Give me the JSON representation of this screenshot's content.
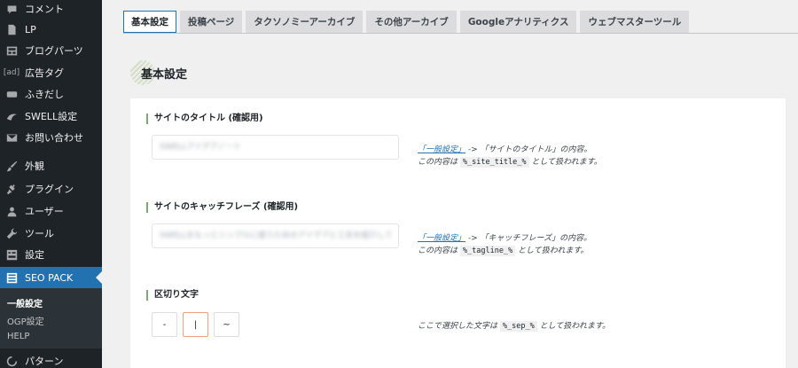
{
  "sidebar": {
    "items": [
      {
        "label": "コメント",
        "icon": "comment-icon"
      },
      {
        "label": "LP",
        "icon": "document-icon"
      },
      {
        "label": "ブログパーツ",
        "icon": "layout-icon"
      },
      {
        "label": "広告タグ",
        "icon_text": "[ad]",
        "icon": "ad-icon"
      },
      {
        "label": "ふきだし",
        "icon": "speech-bubble-icon"
      },
      {
        "label": "SWELL設定",
        "icon": "swell-icon"
      },
      {
        "label": "お問い合わせ",
        "icon": "mail-icon"
      },
      {
        "label": "外観",
        "icon": "paintbrush-icon"
      },
      {
        "label": "プラグイン",
        "icon": "plugin-icon"
      },
      {
        "label": "ユーザー",
        "icon": "user-icon"
      },
      {
        "label": "ツール",
        "icon": "wrench-icon"
      },
      {
        "label": "設定",
        "icon": "settings-icon"
      },
      {
        "label": "SEO PACK",
        "icon": "list-icon"
      },
      {
        "label": "パターン",
        "icon": "pattern-icon"
      }
    ],
    "submenu": [
      "一般設定",
      "OGP設定",
      "HELP"
    ]
  },
  "tabs": [
    "基本設定",
    "投稿ページ",
    "タクソノミーアーカイブ",
    "その他アーカイブ",
    "Googleアナリティクス",
    "ウェブマスターツール"
  ],
  "section_title": "基本設定",
  "fields": {
    "site_title": {
      "label": "サイトのタイトル (確認用)",
      "value": "SWELLアイデアノート",
      "help_link": "「一般設定」",
      "help_line1_rest": " -> 「サイトのタイトル」の内容。",
      "help_line2_pre": "この内容は ",
      "help_code": "%_site_title_%",
      "help_line2_post": " として扱われます。"
    },
    "tagline": {
      "label": "サイトのキャッチフレーズ (確認用)",
      "value": "SWELLをもっとシンプルに使うためのアイデアと工夫を紹介していくブログ",
      "help_link": "「一般設定」",
      "help_line1_rest": " -> 「キャッチフレーズ」の内容。",
      "help_line2_pre": "この内容は ",
      "help_code": "%_tagline_%",
      "help_line2_post": " として扱われます。"
    },
    "separator": {
      "label": "区切り文字",
      "options": [
        "-",
        "|",
        "~"
      ],
      "selected": "|",
      "help_pre": "ここで選択した文字は ",
      "help_code": "%_sep_%",
      "help_post": " として扱われます。"
    }
  }
}
